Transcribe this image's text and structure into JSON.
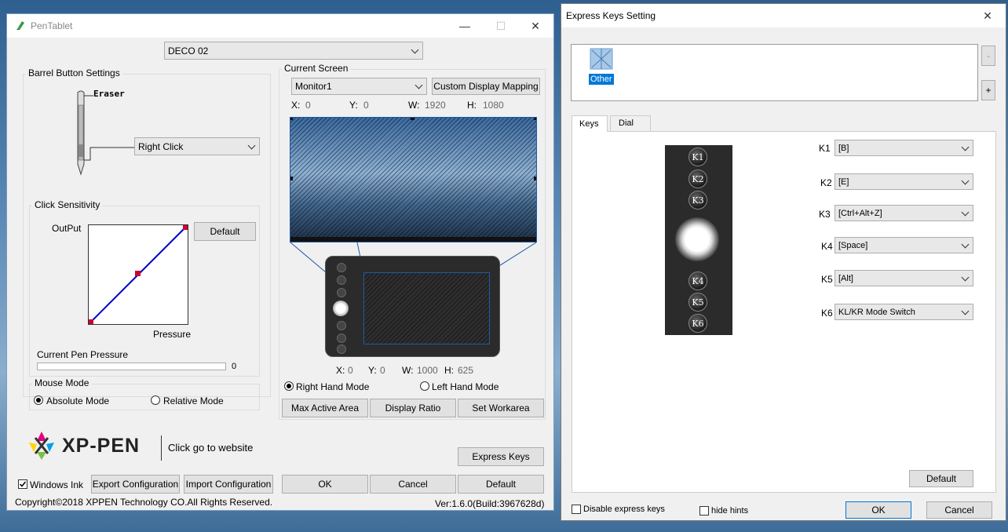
{
  "pentablet": {
    "title": "PenTablet",
    "device": "DECO 02",
    "barrel": {
      "title": "Barrel Button Settings",
      "eraser_label": "Eraser",
      "button_value": "Right Click"
    },
    "click_sensitivity": {
      "title": "Click Sensitivity",
      "output_label": "OutPut",
      "default_label": "Default",
      "pressure_label": "Pressure",
      "current_pressure_label": "Current Pen Pressure",
      "current_pressure_value": "0"
    },
    "mouse_mode": {
      "title": "Mouse Mode",
      "absolute": "Absolute Mode",
      "relative": "Relative Mode",
      "selected": "absolute"
    },
    "current_screen": {
      "title": "Current Screen",
      "monitor": "Monitor1",
      "custom_mapping": "Custom Display Mapping",
      "x_label": "X:",
      "x_value": "0",
      "y_label": "Y:",
      "y_value": "0",
      "w_label": "W:",
      "w_value": "1920",
      "h_label": "H:",
      "h_value": "1080"
    },
    "tablet_area": {
      "x_label": "X:",
      "x_value": "0",
      "y_label": "Y:",
      "y_value": "0",
      "w_label": "W:",
      "w_value": "1000",
      "h_label": "H:",
      "h_value": "625"
    },
    "hand_mode": {
      "right": "Right Hand Mode",
      "left": "Left Hand Mode",
      "selected": "right"
    },
    "area_buttons": {
      "max": "Max Active Area",
      "ratio": "Display Ratio",
      "workarea": "Set Workarea"
    },
    "brand": {
      "logo_text": "XP-PEN",
      "website_link": "Click go to website"
    },
    "express_keys_button": "Express Keys",
    "windows_ink_label": "Windows Ink",
    "export_config": "Export Configuration",
    "import_config": "Import Configuration",
    "ok": "OK",
    "cancel": "Cancel",
    "default": "Default",
    "copyright": "Copyright©2018  XPPEN Technology CO.All Rights Reserved.",
    "version": "Ver:1.6.0(Build:3967628d)"
  },
  "express_keys": {
    "title": "Express Keys Setting",
    "app_item": "Other",
    "minus_btn": "-",
    "plus_btn": "+",
    "tabs": [
      "Keys",
      "Dial"
    ],
    "keys": [
      {
        "label": "K1",
        "value": "[B]"
      },
      {
        "label": "K2",
        "value": "[E]"
      },
      {
        "label": "K3",
        "value": "[Ctrl+Alt+Z]"
      },
      {
        "label": "K4",
        "value": "[Space]"
      },
      {
        "label": "K5",
        "value": "[Alt]"
      },
      {
        "label": "K6",
        "value": "KL/KR Mode Switch"
      }
    ],
    "default_label": "Default",
    "disable_label": "Disable express keys",
    "hide_hints_label": "hide hints",
    "ok": "OK",
    "cancel": "Cancel"
  }
}
